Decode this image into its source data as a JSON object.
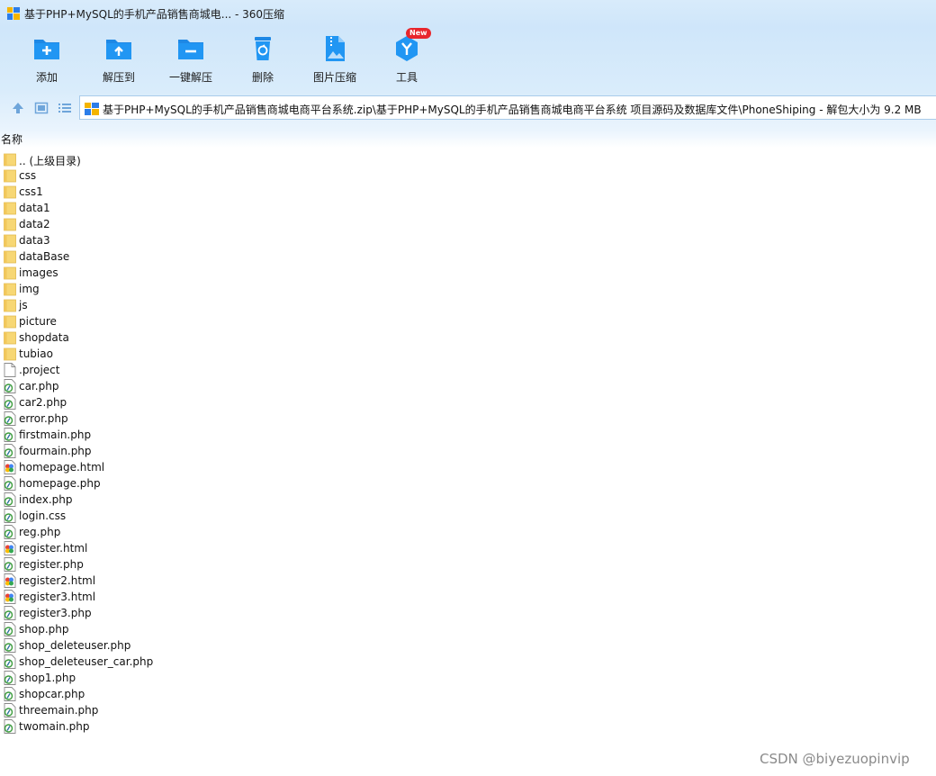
{
  "window": {
    "title": "基于PHP+MySQL的手机产品销售商城电... - 360压缩"
  },
  "toolbar": {
    "items": [
      {
        "label": "添加",
        "icon": "add-folder-icon"
      },
      {
        "label": "解压到",
        "icon": "extract-to-icon"
      },
      {
        "label": "一键解压",
        "icon": "one-click-extract-icon"
      },
      {
        "label": "删除",
        "icon": "delete-icon"
      },
      {
        "label": "图片压缩",
        "icon": "image-compress-icon"
      },
      {
        "label": "工具",
        "icon": "tools-icon",
        "badge": "New"
      }
    ]
  },
  "address": {
    "path": "基于PHP+MySQL的手机产品销售商城电商平台系统.zip\\基于PHP+MySQL的手机产品销售商城电商平台系统 项目源码及数据库文件\\PhoneShiping - 解包大小为 9.2 MB"
  },
  "columns": {
    "name": "名称"
  },
  "files": [
    {
      "name": ".. (上级目录)",
      "type": "folder"
    },
    {
      "name": "css",
      "type": "folder"
    },
    {
      "name": "css1",
      "type": "folder"
    },
    {
      "name": "data1",
      "type": "folder"
    },
    {
      "name": "data2",
      "type": "folder"
    },
    {
      "name": "data3",
      "type": "folder"
    },
    {
      "name": "dataBase",
      "type": "folder"
    },
    {
      "name": "images",
      "type": "folder"
    },
    {
      "name": "img",
      "type": "folder"
    },
    {
      "name": "js",
      "type": "folder"
    },
    {
      "name": "picture",
      "type": "folder"
    },
    {
      "name": "shopdata",
      "type": "folder"
    },
    {
      "name": "tubiao",
      "type": "folder"
    },
    {
      "name": ".project",
      "type": "file"
    },
    {
      "name": "car.php",
      "type": "php"
    },
    {
      "name": "car2.php",
      "type": "php"
    },
    {
      "name": "error.php",
      "type": "php"
    },
    {
      "name": "firstmain.php",
      "type": "php"
    },
    {
      "name": "fourmain.php",
      "type": "php"
    },
    {
      "name": "homepage.html",
      "type": "html"
    },
    {
      "name": "homepage.php",
      "type": "php"
    },
    {
      "name": "index.php",
      "type": "php"
    },
    {
      "name": "login.css",
      "type": "php"
    },
    {
      "name": "reg.php",
      "type": "php"
    },
    {
      "name": "register.html",
      "type": "html"
    },
    {
      "name": "register.php",
      "type": "php"
    },
    {
      "name": "register2.html",
      "type": "html"
    },
    {
      "name": "register3.html",
      "type": "html"
    },
    {
      "name": "register3.php",
      "type": "php"
    },
    {
      "name": "shop.php",
      "type": "php"
    },
    {
      "name": "shop_deleteuser.php",
      "type": "php"
    },
    {
      "name": "shop_deleteuser_car.php",
      "type": "php"
    },
    {
      "name": "shop1.php",
      "type": "php"
    },
    {
      "name": "shopcar.php",
      "type": "php"
    },
    {
      "name": "threemain.php",
      "type": "php"
    },
    {
      "name": "twomain.php",
      "type": "php"
    }
  ],
  "watermark": "CSDN @biyezuopinvip",
  "colors": {
    "toolbar_icon": "#1e88e5",
    "folder": "#f7d774",
    "badge": "#e8262c"
  }
}
